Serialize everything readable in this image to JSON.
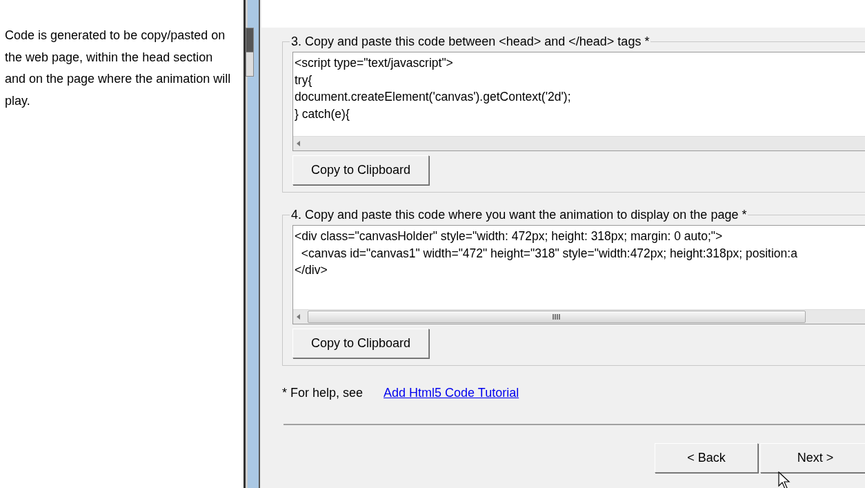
{
  "intro": "Code is generated to be copy/pasted on the web page, within the head section and on the page where the animation will play.",
  "sections": [
    {
      "legend": "3. Copy and paste this code between <head> and </head> tags *",
      "kind": "arrow-only",
      "code": [
        "<script type=\"text/javascript\">",
        "try{",
        "document.createElement('canvas').getContext('2d');",
        "} catch(e){"
      ],
      "button": "Copy to Clipboard"
    },
    {
      "legend": "4. Copy and paste this code where you want the animation to display on the page *",
      "kind": "with-thumb",
      "code": [
        "<div class=\"canvasHolder\" style=\"width: 472px; height: 318px; margin: 0 auto;\">",
        "  <canvas id=\"canvas1\" width=\"472\" height=\"318\" style=\"width:472px; height:318px; position:a",
        "</div>"
      ],
      "button": "Copy to Clipboard"
    }
  ],
  "help": {
    "prefix": "* For help, see",
    "link": "Add Html5 Code Tutorial"
  },
  "buttons": [
    {
      "label": "< Back"
    },
    {
      "label": "Next >"
    }
  ]
}
